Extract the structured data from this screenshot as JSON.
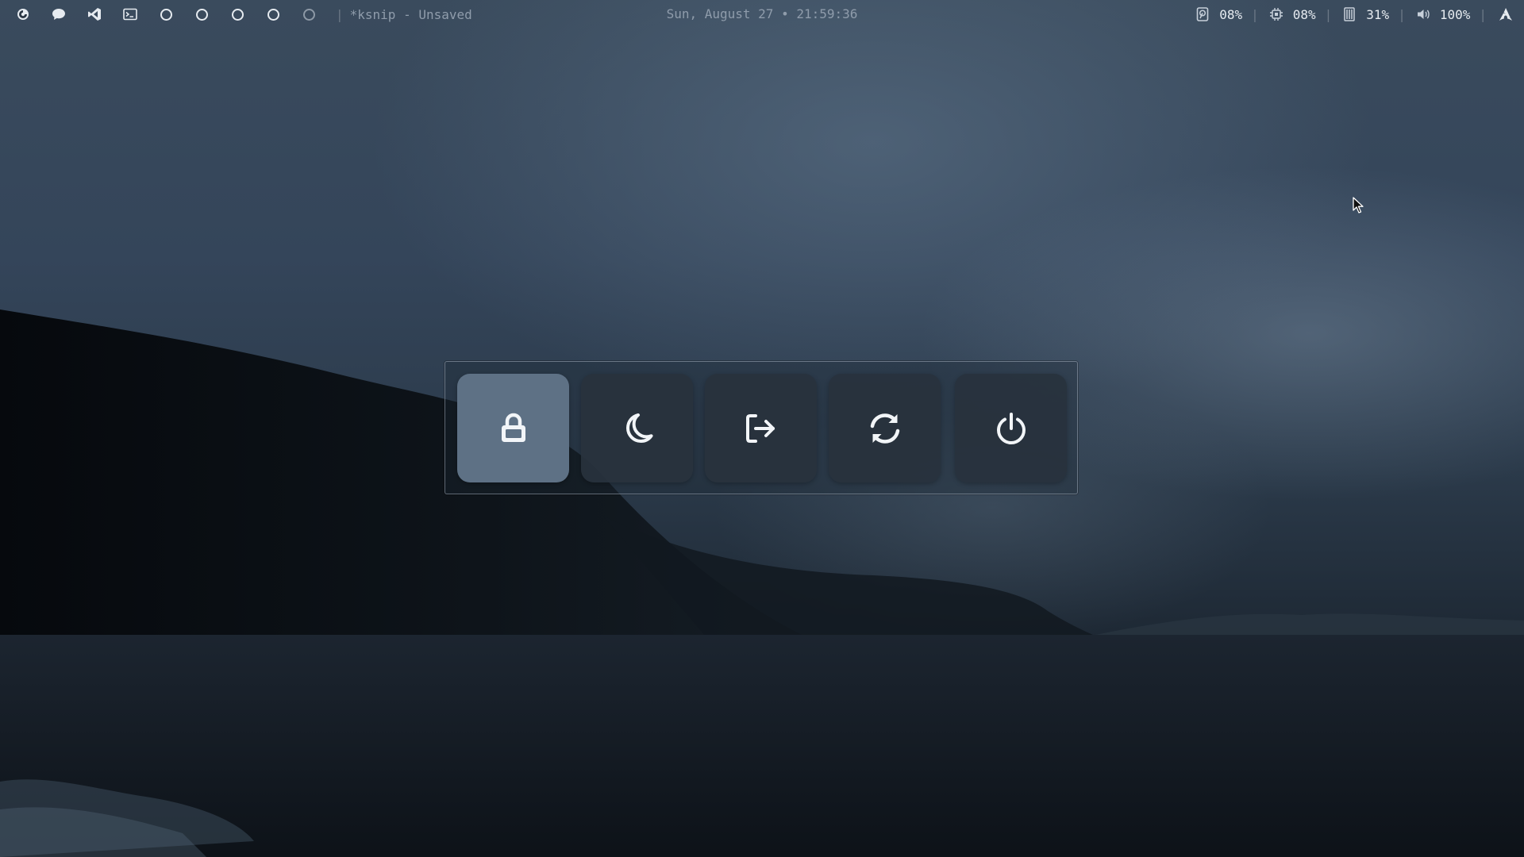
{
  "topbar": {
    "launcher_icon": "arch-swirl-icon",
    "apps": [
      {
        "name": "chat-icon"
      },
      {
        "name": "vscode-icon"
      },
      {
        "name": "terminal-icon"
      }
    ],
    "workspaces": [
      {
        "id": "1",
        "state": "occupied"
      },
      {
        "id": "2",
        "state": "occupied"
      },
      {
        "id": "3",
        "state": "occupied"
      },
      {
        "id": "4",
        "state": "occupied"
      },
      {
        "id": "5",
        "state": "empty"
      }
    ],
    "separator": "|",
    "window_title": "*ksnip - Unsaved",
    "clock": "Sun, August 27 • 21:59:36",
    "stats": {
      "disk": "08%",
      "cpu": "08%",
      "memory": "31%",
      "volume": "100%"
    },
    "end_icon": "arch-logo-icon"
  },
  "power_menu": {
    "buttons": [
      {
        "name": "lock",
        "icon": "lock-icon",
        "active": true
      },
      {
        "name": "suspend",
        "icon": "moon-icon",
        "active": false
      },
      {
        "name": "logout",
        "icon": "logout-icon",
        "active": false
      },
      {
        "name": "reboot",
        "icon": "refresh-icon",
        "active": false
      },
      {
        "name": "shutdown",
        "icon": "power-icon",
        "active": false
      }
    ]
  },
  "colors": {
    "active_button": "#5e7185",
    "button": "#28323d",
    "text": "#8f9cab",
    "icon": "#e6ebf0"
  }
}
